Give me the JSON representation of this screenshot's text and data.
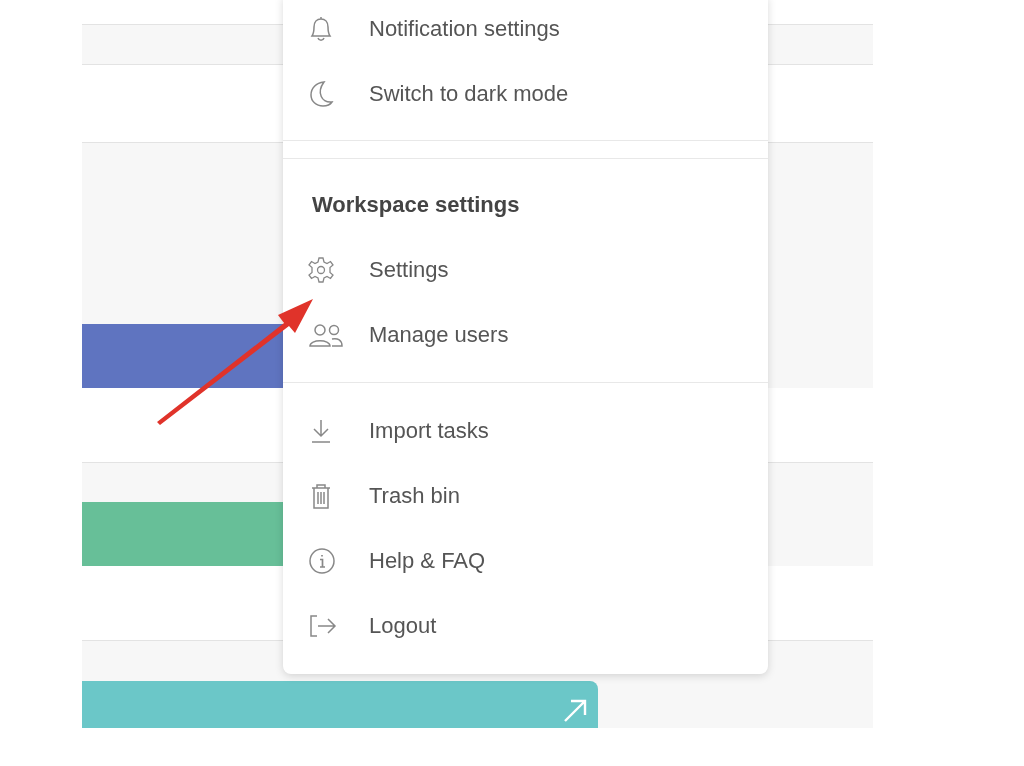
{
  "task_bars": [
    {
      "color": "#5f74c0"
    },
    {
      "color": "#67bf98"
    },
    {
      "color": "#6bc7c8"
    }
  ],
  "menu": {
    "sections": [
      {
        "items": [
          {
            "label": "Notification settings"
          },
          {
            "label": "Switch to dark mode"
          }
        ]
      },
      {
        "title": "Workspace settings",
        "items": [
          {
            "label": "Settings"
          },
          {
            "label": "Manage users"
          }
        ]
      },
      {
        "items": [
          {
            "label": "Import tasks"
          },
          {
            "label": "Trash bin"
          },
          {
            "label": "Help & FAQ"
          },
          {
            "label": "Logout"
          }
        ]
      }
    ]
  }
}
